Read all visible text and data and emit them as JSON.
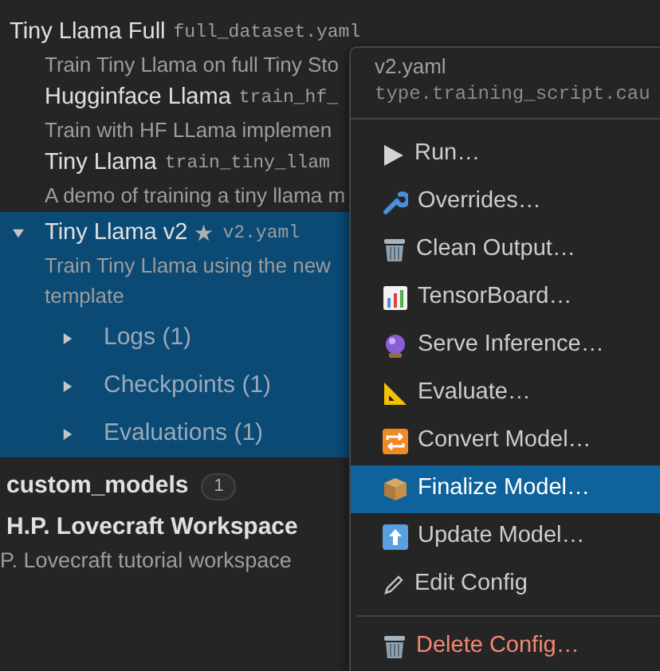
{
  "tree": {
    "items": [
      {
        "kind": "config",
        "title": "Tiny Llama Full",
        "file": "full_dataset.yaml",
        "description": "Train Tiny Llama on full Tiny Sto",
        "selected": false
      },
      {
        "kind": "config",
        "title": "Hugginface Llama",
        "file": "train_hf_",
        "description": "Train with HF LLama implemen",
        "selected": false
      },
      {
        "kind": "config",
        "title": "Tiny Llama",
        "file": "train_tiny_llam",
        "description": "A demo of training a tiny llama m",
        "selected": false
      },
      {
        "kind": "config",
        "title": "Tiny Llama v2",
        "star": "★",
        "file": "v2.yaml",
        "description": "Train Tiny Llama using the new template",
        "selected": true,
        "expanded": true,
        "children": [
          {
            "label": "Logs (1)",
            "expanded": false
          },
          {
            "label": "Checkpoints (1)",
            "expanded": false
          },
          {
            "label": "Evaluations (1)",
            "expanded": false
          }
        ]
      },
      {
        "kind": "group",
        "title": "custom_models",
        "badge": "1"
      },
      {
        "kind": "workspace",
        "title": "H.P. Lovecraft Workspace",
        "description": "P. Lovecraft tutorial workspace"
      }
    ]
  },
  "context_menu": {
    "header": {
      "title": "v2.yaml",
      "subtitle": "type.training_script.cau"
    },
    "items": [
      {
        "kind": "run",
        "label": "Run…",
        "selected": false
      },
      {
        "kind": "overrides",
        "label": "Overrides…",
        "selected": false
      },
      {
        "kind": "clean",
        "label": "Clean Output…",
        "selected": false
      },
      {
        "kind": "tensorboard",
        "label": "TensorBoard…",
        "selected": false
      },
      {
        "kind": "serve",
        "label": "Serve Inference…",
        "selected": false
      },
      {
        "kind": "evaluate",
        "label": "Evaluate…",
        "selected": false
      },
      {
        "kind": "convert",
        "label": "Convert Model…",
        "selected": false
      },
      {
        "kind": "finalize",
        "label": "Finalize Model…",
        "selected": true
      },
      {
        "kind": "update",
        "label": "Update Model…",
        "selected": false
      },
      {
        "kind": "edit",
        "label": "Edit Config",
        "selected": false
      },
      {
        "kind": "separator"
      },
      {
        "kind": "delete",
        "label": "Delete Config…",
        "selected": false
      }
    ]
  }
}
